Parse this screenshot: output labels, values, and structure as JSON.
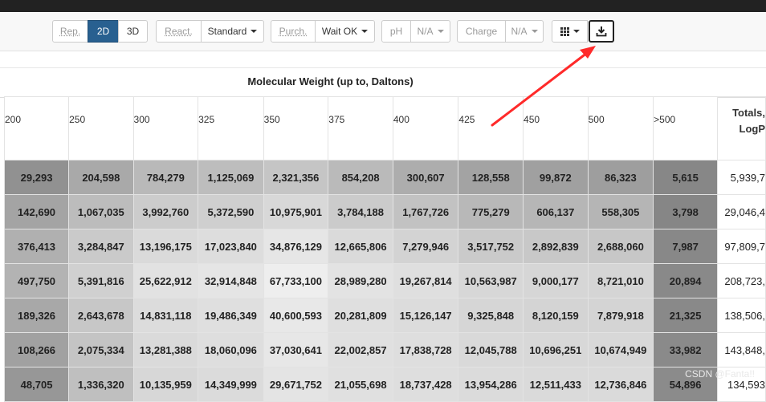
{
  "toolbar": {
    "rep": "Rep.",
    "d2": "2D",
    "d3": "3D",
    "react": "React.",
    "react_value": "Standard",
    "purch": "Purch.",
    "purch_value": "Wait OK",
    "ph": "pH",
    "ph_value": "N/A",
    "charge": "Charge",
    "charge_value": "N/A"
  },
  "table_title": "Molecular Weight (up to, Daltons)",
  "columns": [
    "200",
    "250",
    "300",
    "325",
    "350",
    "375",
    "400",
    "425",
    "450",
    "500",
    ">500"
  ],
  "totals_header": "Totals, LogP",
  "rows": [
    {
      "cells": [
        "29,293",
        "204,598",
        "784,279",
        "1,125,069",
        "2,321,356",
        "854,208",
        "300,607",
        "128,558",
        "99,872",
        "86,323",
        "5,615"
      ],
      "total": "5,939,7"
    },
    {
      "cells": [
        "142,690",
        "1,067,035",
        "3,992,760",
        "5,372,590",
        "10,975,901",
        "3,784,188",
        "1,767,726",
        "775,279",
        "606,137",
        "558,305",
        "3,798"
      ],
      "total": "29,046,4"
    },
    {
      "cells": [
        "376,413",
        "3,284,847",
        "13,196,175",
        "17,023,840",
        "34,876,129",
        "12,665,806",
        "7,279,946",
        "3,517,752",
        "2,892,839",
        "2,688,060",
        "7,987"
      ],
      "total": "97,809,7"
    },
    {
      "cells": [
        "497,750",
        "5,391,816",
        "25,622,912",
        "32,914,848",
        "67,733,100",
        "28,989,280",
        "19,267,814",
        "10,563,987",
        "9,000,177",
        "8,721,010",
        "20,894"
      ],
      "total": "208,723,"
    },
    {
      "cells": [
        "189,326",
        "2,643,678",
        "14,831,118",
        "19,486,349",
        "40,600,593",
        "20,281,809",
        "15,126,147",
        "9,325,848",
        "8,120,159",
        "7,879,918",
        "21,325"
      ],
      "total": "138,506,"
    },
    {
      "cells": [
        "108,266",
        "2,075,334",
        "13,281,388",
        "18,060,096",
        "37,030,641",
        "22,002,857",
        "17,838,728",
        "12,045,788",
        "10,696,251",
        "10,674,949",
        "33,982"
      ],
      "total": "143,848,"
    },
    {
      "cells": [
        "48,705",
        "1,336,320",
        "10,135,959",
        "14,349,999",
        "29,671,752",
        "21,055,698",
        "18,737,428",
        "13,954,286",
        "12,511,433",
        "12,736,846",
        "54,896"
      ],
      "total": "134,593"
    }
  ],
  "watermark": "CSDN @Fanta!!",
  "colors": {
    "active": "#286090",
    "arrow": "#ff2a2a",
    "topbar": "#222222"
  },
  "icons": [
    "grid-icon",
    "download-icon",
    "caret-down-icon"
  ]
}
